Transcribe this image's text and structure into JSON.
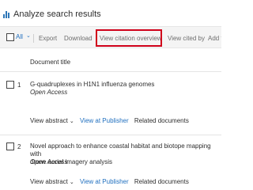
{
  "header": {
    "title": "Analyze search results",
    "icon": "bar-chart-icon"
  },
  "toolbar": {
    "select_label": "All",
    "items": [
      "Export",
      "Download",
      "View citation overview",
      "View cited by",
      "Add t"
    ]
  },
  "table": {
    "column_header": "Document title"
  },
  "results": [
    {
      "number": "1",
      "title_lines": [
        "G-quadruplexes in H1N1 influenza genomes"
      ],
      "access": "Open Access",
      "actions": {
        "abstract": "View abstract",
        "publisher": "View at Publisher",
        "related": "Related documents"
      }
    },
    {
      "number": "2",
      "title_lines": [
        "Novel approach to enhance coastal habitat and biotope mapping with",
        "drone aerial imagery analysis"
      ],
      "access": "Open Access",
      "actions": {
        "abstract": "View abstract",
        "publisher": "View at Publisher",
        "related": "Related documents"
      }
    }
  ],
  "colors": {
    "link": "#1f6fbf",
    "highlight": "#d0021b",
    "toolbar_bg": "#f4f4f4"
  }
}
